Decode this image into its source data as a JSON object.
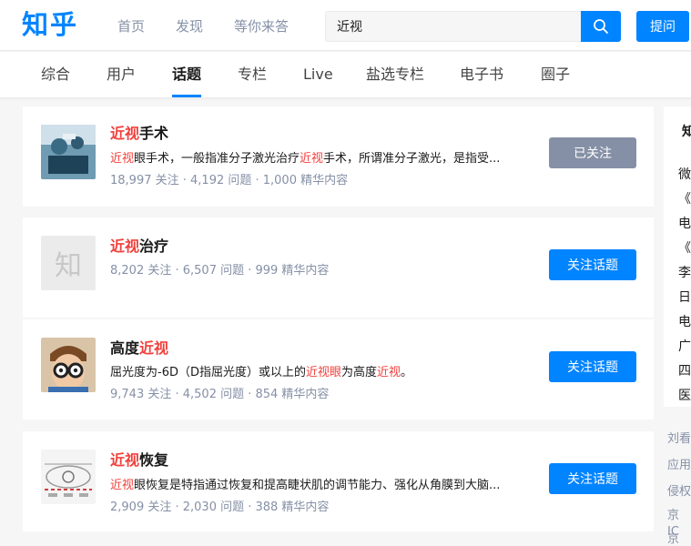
{
  "header": {
    "logo": "知乎",
    "nav": [
      "首页",
      "发现",
      "等你来答"
    ],
    "search_value": "近视",
    "ask_label": "提问"
  },
  "tabs": [
    "综合",
    "用户",
    "话题",
    "专栏",
    "Live",
    "盐选专栏",
    "电子书",
    "圈子"
  ],
  "active_tab": "话题",
  "results": [
    {
      "title_hl": "近视",
      "title_rest": "手术",
      "desc_parts": [
        "近视",
        "眼手术，一般指准分子激光治疗",
        "近视",
        "手术，所谓准分子激光，是指受..."
      ],
      "meta": "18,997 关注 · 4,192 问题 · 1,000 精华内容",
      "button": "已关注"
    },
    {
      "title_hl": "近视",
      "title_rest": "治疗",
      "desc_parts": [],
      "meta": "8,202 关注 · 6,507 问题 · 999 精华内容",
      "button": "关注话题",
      "thumb_char": "知"
    },
    {
      "title_pre": "高度",
      "title_hl": "近视",
      "desc_parts": [
        "屈光度为-6D（D指屈光度）或以上的",
        "近视眼",
        "为高度",
        "近视",
        "。"
      ],
      "meta": "9,743 关注 · 4,502 问题 · 854 精华内容",
      "button": "关注话题"
    },
    {
      "title_hl": "近视",
      "title_rest": "恢复",
      "desc_parts": [
        "近视",
        "眼恢复是特指通过恢复和提高睫状肌的调节能力、强化从角膜到大脑..."
      ],
      "meta": "2,909 关注 · 2,030 问题 · 388 精华内容",
      "button": "关注话题"
    }
  ],
  "sidebar": {
    "title": "知",
    "items": [
      "微",
      "《",
      "电",
      "《",
      "李",
      "日",
      "电",
      "广",
      "四",
      "医"
    ],
    "footer": [
      "刘看",
      "应用",
      "侵权",
      "京 IC",
      "京 IC"
    ]
  },
  "colors": {
    "accent": "#0084ff",
    "highlight": "#f1403c",
    "muted": "#8590a6"
  }
}
